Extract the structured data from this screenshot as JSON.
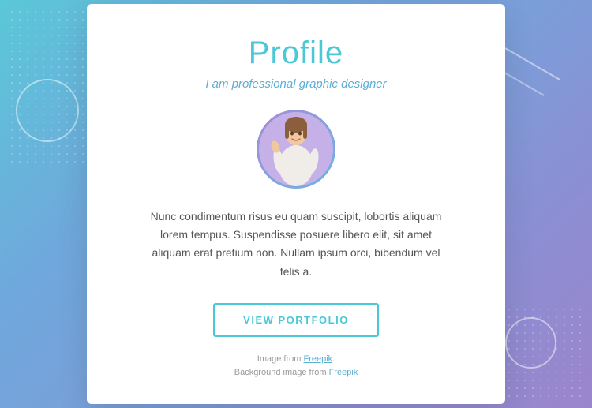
{
  "background": {
    "gradient_start": "#5bc8d8",
    "gradient_end": "#9b85cc"
  },
  "card": {
    "title": "Profile",
    "subtitle": "I am professional graphic designer",
    "bio": "Nunc condimentum risus eu quam suscipit, lobortis aliquam lorem tempus. Suspendisse posuere libero elit, sit amet aliquam erat pretium non. Nullam ipsum orci, bibendum vel felis a.",
    "button_label": "VIEW PORTFOLIO",
    "footer_line1": "Image from Freepik.",
    "footer_line2": "Background image from Freepik"
  }
}
